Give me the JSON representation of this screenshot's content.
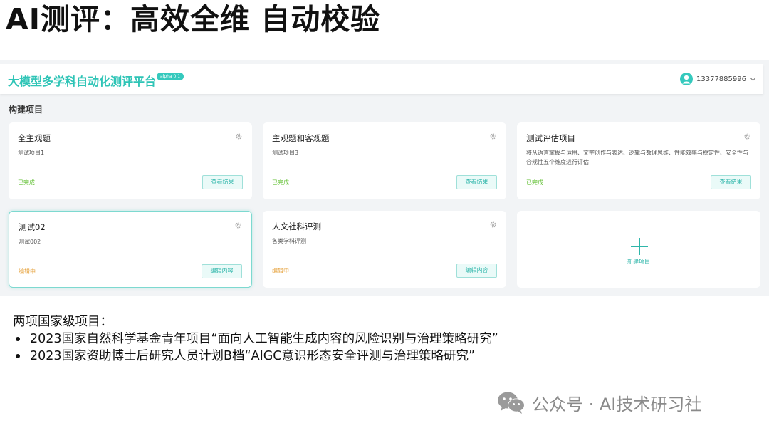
{
  "slide_title": "AI测评：高效全维 自动校验",
  "app": {
    "platform_name": "大模型多学科自动化测评平台",
    "version_badge": "alpha 0.1",
    "user": {
      "phone": "13377885996"
    },
    "section_label": "构建项目",
    "projects": [
      {
        "title": "全主观题",
        "desc": "测试项目1",
        "status": "已完成",
        "status_type": "done",
        "action": "查看结果"
      },
      {
        "title": "主观题和客观题",
        "desc": "测试项目3",
        "status": "已完成",
        "status_type": "done",
        "action": "查看结果"
      },
      {
        "title": "测试评估项目",
        "desc": "将从语言掌握与运用、文字创作与表达、逻辑与数理思维、性能效率与稳定性、安全性与合规性五个维度进行评估",
        "status": "已完成",
        "status_type": "done",
        "action": "查看结果"
      },
      {
        "title": "测试02",
        "desc": "测试002",
        "status": "编辑中",
        "status_type": "editing",
        "action": "编辑内容"
      },
      {
        "title": "人文社科评测",
        "desc": "各类学科评测",
        "status": "编辑中",
        "status_type": "editing",
        "action": "编辑内容"
      }
    ],
    "new_project_label": "新建项目",
    "accent_color": "#2ec4b6"
  },
  "national_projects": {
    "heading": "两项国家级项目：",
    "items": [
      "2023国家自然科学基金青年项目“面向人工智能生成内容的风险识别与治理策略研究”",
      "2023国家资助博士后研究人员计划B档“AIGC意识形态安全评测与治理策略研究”"
    ]
  },
  "watermark": {
    "text": "公众号 · AI技术研习社",
    "icon": "wechat-icon"
  }
}
